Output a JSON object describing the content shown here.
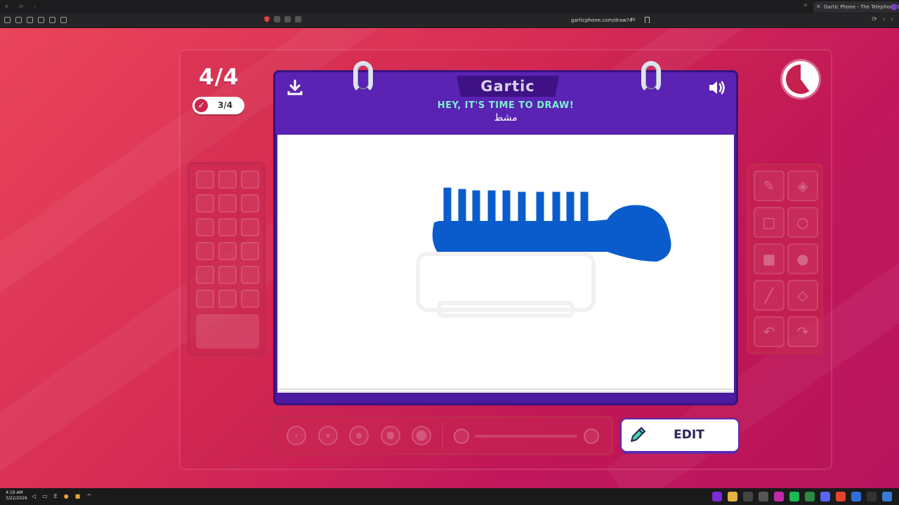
{
  "browser": {
    "tab_title": "Gartic Phone - The Telephone G",
    "url": "garticphone.com/draw?4"
  },
  "game": {
    "round": "4/4",
    "done_count": "3/4",
    "logo": "Gartic",
    "headline": "HEY, IT'S TIME TO DRAW!",
    "prompt_word": "مشط",
    "edit_label": "EDIT",
    "timer_remaining_fraction": 0.6,
    "drawing_color": "#0a5ccc"
  },
  "tools": [
    "pencil-icon",
    "eraser-icon",
    "rectangle-icon",
    "ellipse-icon",
    "filled-rectangle-icon",
    "filled-ellipse-icon",
    "line-icon",
    "fill-bucket-icon",
    "undo-icon",
    "redo-icon"
  ],
  "taskbar": {
    "time": "4:19 AM",
    "date": "3/22/2026"
  }
}
